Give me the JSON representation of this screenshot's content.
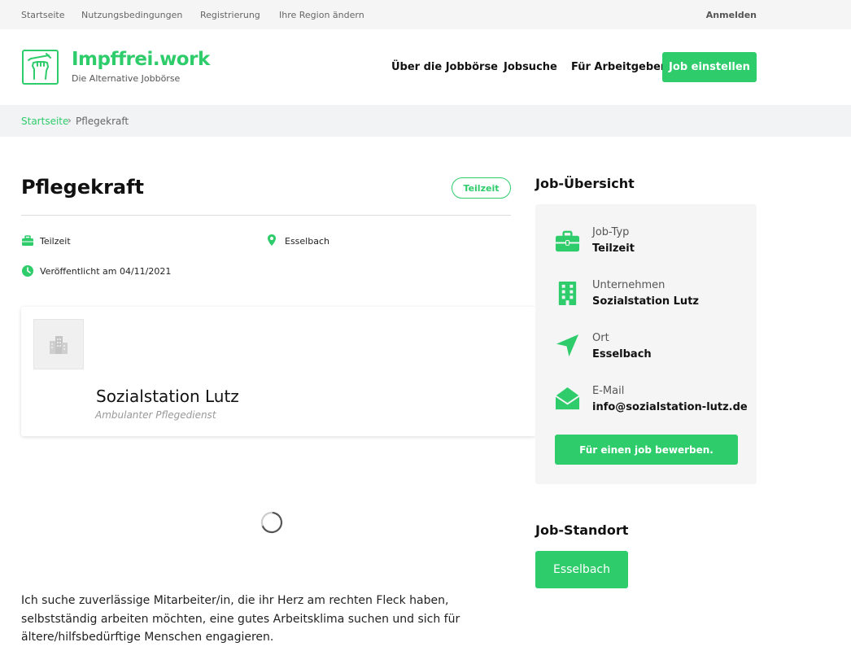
{
  "topbar": {
    "links": [
      "Startseite",
      "Nutzungsbedingungen",
      "Registrierung",
      "Ihre Region ändern"
    ],
    "login": "Anmelden"
  },
  "header": {
    "brand": "Impffrei.work",
    "tagline": "Die Alternative Jobbörse",
    "nav": [
      "Über die Jobbörse",
      "Jobsuche",
      "Für Arbeitgeber"
    ],
    "cta": "Job einstellen"
  },
  "breadcrumb": {
    "home": "Startseite",
    "separator": "›",
    "current": "Pflegekraft"
  },
  "job": {
    "title": "Pflegekraft",
    "badge": "Teilzeit",
    "type": "Teilzeit",
    "location": "Esselbach",
    "published": "Veröffentlicht am 04/11/2021",
    "company": "Sozialstation Lutz",
    "company_subtitle": "Ambulanter Pflegedienst",
    "description": "Ich suche zuverlässige Mitarbeiter/in, die ihr Herz am rechten Fleck haben, selbstständig arbeiten möchten, eine gutes Arbeitsklima suchen und sich für ältere/hilfsbedürftige Menschen engagieren."
  },
  "sidebar": {
    "overview_title": "Job-Übersicht",
    "items": [
      {
        "label": "Job-Typ",
        "value": "Teilzeit",
        "icon": "briefcase-icon"
      },
      {
        "label": "Unternehmen",
        "value": "Sozialstation Lutz",
        "icon": "building-icon"
      },
      {
        "label": "Ort",
        "value": "Esselbach",
        "icon": "location-arrow-icon"
      },
      {
        "label": "E-Mail",
        "value": "info@sozialstation-lutz.de",
        "icon": "envelope-open-icon"
      }
    ],
    "apply": "Für einen job bewerben.",
    "location_title": "Job-Standort",
    "location_button": "Esselbach"
  },
  "colors": {
    "accent": "#2ecc6b",
    "topbar_bg": "#f5f5f6",
    "breadcrumb_bg": "#f2f3f5"
  }
}
